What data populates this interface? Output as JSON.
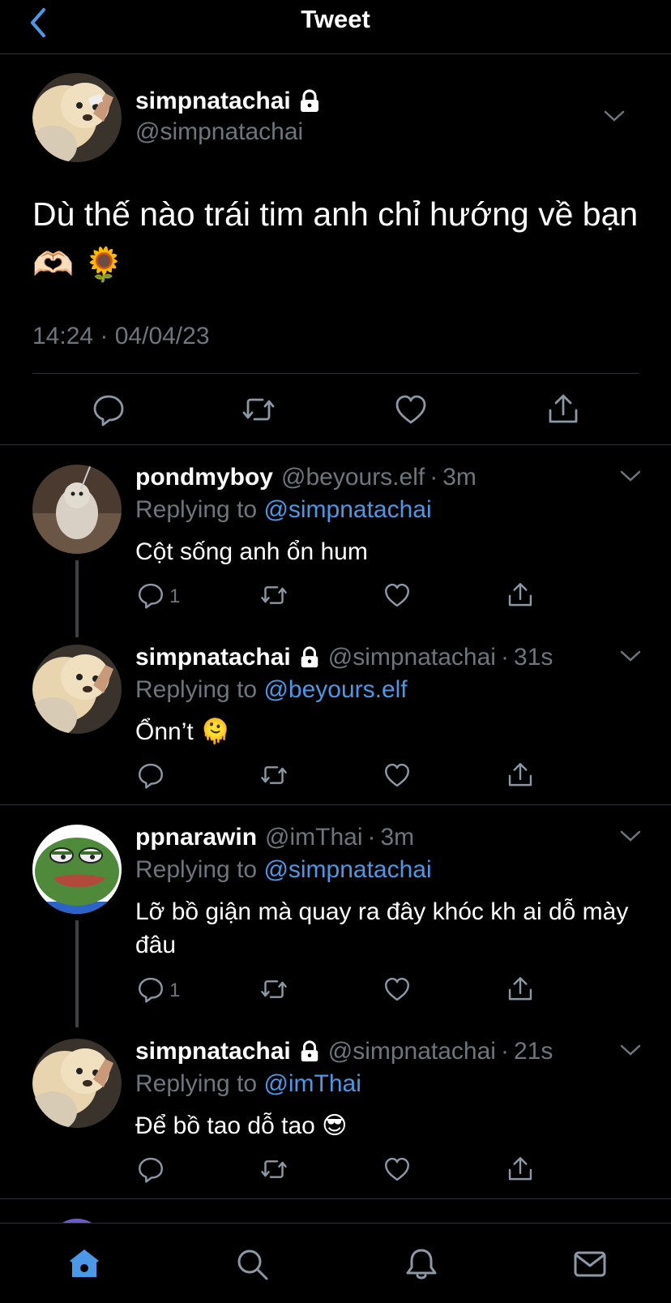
{
  "header": {
    "title": "Tweet",
    "back_icon": "chevron-left-icon",
    "accent": "#4a99e9"
  },
  "main_tweet": {
    "name": "simpnatachai",
    "handle": "@simpnatachai",
    "text": "Dù thế nào trái tim anh chỉ hướng về bạn 🫶🏻 🌻",
    "timestamp": "14:24 · 04/04/23",
    "locked": true
  },
  "replies": [
    {
      "name": "pondmyboy",
      "handle": "@beyours.elf",
      "dot": "·",
      "time": "3m",
      "replying_prefix": "Replying to",
      "replying_to": "@simpnatachai",
      "text": "Cột sống anh ổn hum",
      "reply_count": "1"
    },
    {
      "name": "simpnatachai",
      "handle": "@simpnatachai",
      "dot": "·",
      "time": "31s",
      "replying_prefix": "Replying to",
      "replying_to": "@beyours.elf",
      "text": "Ổnn’t 🫠",
      "reply_count": ""
    },
    {
      "name": "ppnarawin",
      "handle": "@imThai",
      "dot": "·",
      "time": "3m",
      "replying_prefix": "Replying to",
      "replying_to": "@simpnatachai",
      "text": "Lỡ bồ giận mà quay ra đây khóc kh ai dỗ mày đâu",
      "reply_count": "1"
    },
    {
      "name": "simpnatachai",
      "handle": "@simpnatachai",
      "dot": "·",
      "time": "21s",
      "replying_prefix": "Replying to",
      "replying_to": "@imThai",
      "text": "Để bồ tao dỗ tao 😎",
      "reply_count": ""
    }
  ],
  "bottom_nav": {
    "items": [
      "home-icon",
      "search-icon",
      "notifications-icon",
      "messages-icon"
    ],
    "active": "home-icon"
  }
}
